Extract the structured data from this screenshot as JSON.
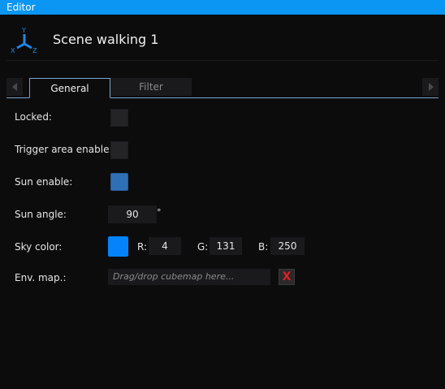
{
  "window": {
    "title": "Editor"
  },
  "header": {
    "scene_name": "Scene walking 1",
    "axis_labels": {
      "x": "X",
      "y": "Y",
      "z": "Z"
    }
  },
  "tabs": [
    {
      "label": "General",
      "active": true
    },
    {
      "label": "Filter",
      "active": false
    }
  ],
  "properties": {
    "locked": {
      "label": "Locked:",
      "checked": false
    },
    "trigger_area": {
      "label": "Trigger area enable:",
      "checked": false
    },
    "sun_enable": {
      "label": "Sun enable:",
      "checked": true
    },
    "sun_angle": {
      "label": "Sun angle:",
      "value": "90",
      "unit": "°"
    },
    "sky_color": {
      "label": "Sky color:",
      "r_label": "R:",
      "r": "4",
      "g_label": "G:",
      "g": "131",
      "b_label": "B:",
      "b": "250",
      "swatch_color": "#0483fa"
    },
    "env_map": {
      "label": "Env. map.:",
      "placeholder": "Drag/drop cubemap here...",
      "clear_label": "X"
    }
  },
  "colors": {
    "accent": "#0a96f2",
    "checkbox_checked": "#2f6fb6",
    "clear_icon": "#e0201f"
  }
}
